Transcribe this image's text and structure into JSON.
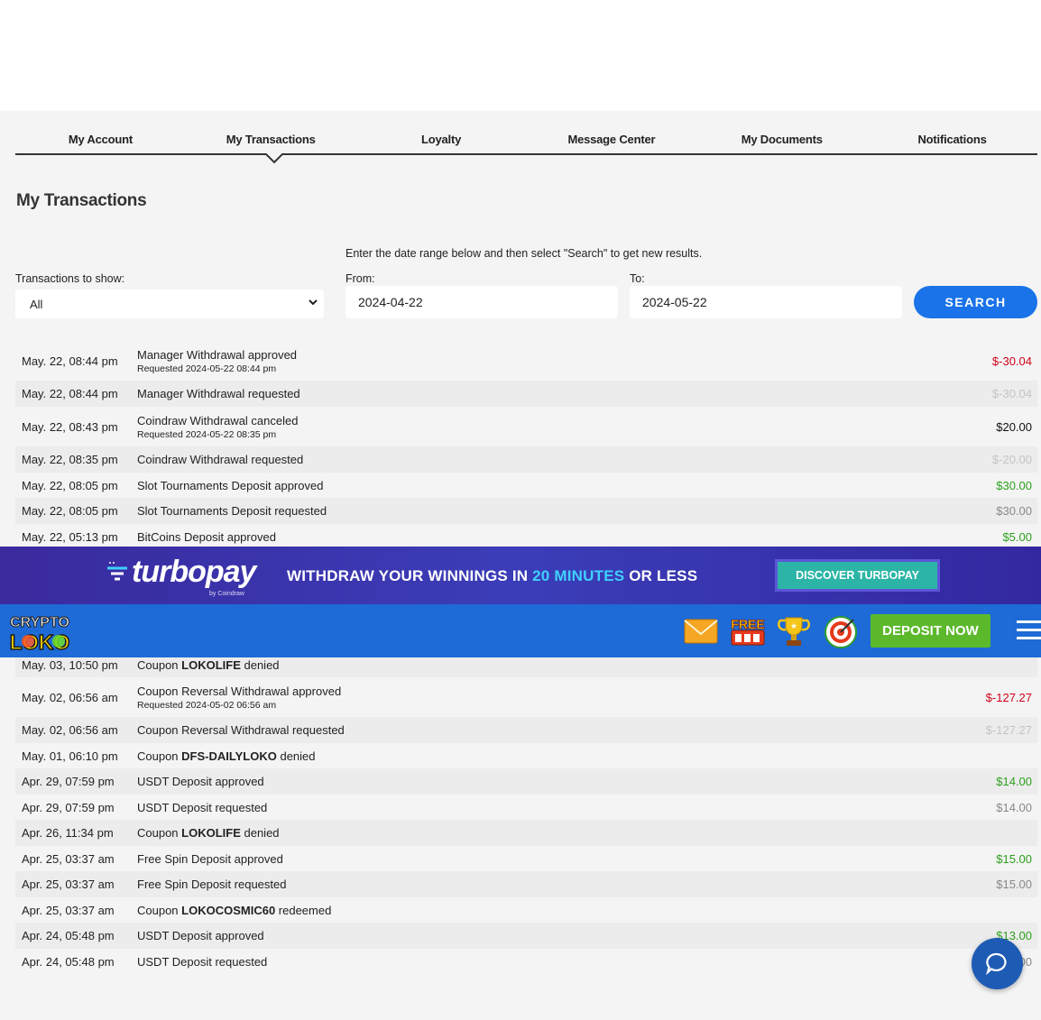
{
  "tabs": [
    "My Account",
    "My Transactions",
    "Loyalty",
    "Message Center",
    "My Documents",
    "Notifications"
  ],
  "active_tab": "My Transactions",
  "page_title": "My Transactions",
  "hint": "Enter the date range below and then select \"Search\" to get new results.",
  "filter": {
    "show_label": "Transactions to show:",
    "show_value": "All",
    "from_label": "From:",
    "from_value": "2024-04-22",
    "to_label": "To:",
    "to_value": "2024-05-22",
    "search_label": "SEARCH"
  },
  "transactions_top": [
    {
      "date": "May. 22, 08:44 pm",
      "desc": "Manager Withdrawal approved",
      "sub": "Requested 2024-05-22 08:44 pm",
      "amount": "$-30.04",
      "amount_color": "red"
    },
    {
      "date": "May. 22, 08:44 pm",
      "desc": "Manager Withdrawal requested",
      "amount": "$-30.04",
      "amount_color": "lightgray"
    },
    {
      "date": "May. 22, 08:43 pm",
      "desc": "Coindraw Withdrawal canceled",
      "sub": "Requested 2024-05-22 08:35 pm",
      "amount": "$20.00",
      "amount_color": "black"
    },
    {
      "date": "May. 22, 08:35 pm",
      "desc": "Coindraw Withdrawal requested",
      "amount": "$-20.00",
      "amount_color": "lightgray"
    },
    {
      "date": "May. 22, 08:05 pm",
      "desc": "Slot Tournaments Deposit approved",
      "amount": "$30.00",
      "amount_color": "green"
    },
    {
      "date": "May. 22, 08:05 pm",
      "desc": "Slot Tournaments Deposit requested",
      "amount": "$30.00",
      "amount_color": "gray"
    },
    {
      "date": "May. 22, 05:13 pm",
      "desc": "BitCoins Deposit approved",
      "amount": "$5.00",
      "amount_color": "green"
    }
  ],
  "transactions_bottom": [
    {
      "date": "May. 03, 10:50 pm",
      "desc_pre": "Coupon ",
      "desc_bold": "LOKOLIFE",
      "desc_post": " denied",
      "amount": ""
    },
    {
      "date": "May. 02, 06:56 am",
      "desc": "Coupon Reversal Withdrawal approved",
      "sub": "Requested 2024-05-02 06:56 am",
      "amount": "$-127.27",
      "amount_color": "red"
    },
    {
      "date": "May. 02, 06:56 am",
      "desc": "Coupon Reversal Withdrawal requested",
      "amount": "$-127.27",
      "amount_color": "lightgray"
    },
    {
      "date": "May. 01, 06:10 pm",
      "desc_pre": "Coupon ",
      "desc_bold": "DFS-DAILYLOKO",
      "desc_post": " denied",
      "amount": ""
    },
    {
      "date": "Apr. 29, 07:59 pm",
      "desc": "USDT Deposit approved",
      "amount": "$14.00",
      "amount_color": "green"
    },
    {
      "date": "Apr. 29, 07:59 pm",
      "desc": "USDT Deposit requested",
      "amount": "$14.00",
      "amount_color": "gray"
    },
    {
      "date": "Apr. 26, 11:34 pm",
      "desc_pre": "Coupon ",
      "desc_bold": "LOKOLIFE",
      "desc_post": " denied",
      "amount": ""
    },
    {
      "date": "Apr. 25, 03:37 am",
      "desc": "Free Spin Deposit approved",
      "amount": "$15.00",
      "amount_color": "green"
    },
    {
      "date": "Apr. 25, 03:37 am",
      "desc": "Free Spin Deposit requested",
      "amount": "$15.00",
      "amount_color": "gray"
    },
    {
      "date": "Apr. 25, 03:37 am",
      "desc_pre": "Coupon ",
      "desc_bold": "LOKOCOSMIC60",
      "desc_post": " redeemed",
      "amount": ""
    },
    {
      "date": "Apr. 24, 05:48 pm",
      "desc": "USDT Deposit approved",
      "amount": "$13.00",
      "amount_color": "green"
    },
    {
      "date": "Apr. 24, 05:48 pm",
      "desc": "USDT Deposit requested",
      "amount": "$13.00",
      "amount_color": "gray"
    }
  ],
  "banner": {
    "logo": "turbopay",
    "by": "by Coindraw",
    "text_pre": "WITHDRAW YOUR WINNINGS IN ",
    "text_hl": "20 MINUTES",
    "text_post": " OR LESS",
    "button": "DISCOVER TURBOPAY"
  },
  "navbar": {
    "logo_line1": "CRYPTO",
    "logo_line2": "LOKO",
    "icons": [
      "mail-icon",
      "free-icon",
      "trophy-icon",
      "target-icon"
    ],
    "free_label": "FREE",
    "deposit_label": "DEPOSIT NOW"
  },
  "colors": {
    "page_bg": "#f4f4f4",
    "search_blue": "#1a73e8",
    "navbar_blue": "#1e6ad6",
    "deposit_green": "#5cb92c",
    "banner_purple": "#3a2a9e",
    "red": "#d0021b",
    "green": "#2ca01c"
  }
}
